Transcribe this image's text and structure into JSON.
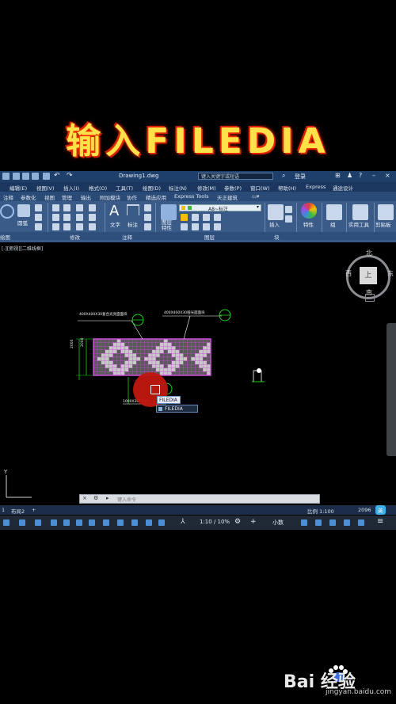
{
  "overlay": {
    "title": "输入FILEDIA"
  },
  "titlebar": {
    "document": "Drawing1.dwg",
    "search_placeholder": "键入关键字或短语",
    "user": "登录"
  },
  "menubar": {
    "items": [
      "编辑(E)",
      "视图(V)",
      "插入(I)",
      "格式(O)",
      "工具(T)",
      "绘图(D)",
      "标注(N)",
      "修改(M)",
      "参数(P)",
      "窗口(W)",
      "帮助(H)",
      "Express",
      "通途设计"
    ]
  },
  "ribbon_tabs": {
    "items": [
      "注释",
      "参数化",
      "视图",
      "管理",
      "输出",
      "附加模块",
      "协作",
      "精选应用",
      "Express Tools",
      "天正建筑"
    ]
  },
  "ribbon": {
    "layer_name": "A8~标注",
    "labels": {
      "line": "圆弧",
      "text": "文字",
      "dimension": "标注",
      "layer_props": "图层\n特性",
      "insert": "插入",
      "properties": "特性",
      "group": "组",
      "utilities": "实用工具",
      "clipboard": "剪贴板"
    },
    "panels": [
      "绘图",
      "修改",
      "注释",
      "图层",
      "块"
    ]
  },
  "viewport": {
    "label": "[-][俯视][二维线框]"
  },
  "viewcube": {
    "north": "北",
    "south": "南",
    "east": "东",
    "west": "西",
    "face": "上"
  },
  "drawing": {
    "label_left": "400X400X30复合光亮面面块",
    "label_right": "400X400X30哑光面面块",
    "label_bottom": "1000X300X30",
    "dim_a": "2000",
    "dim_b": "2000"
  },
  "command": {
    "typed": "FILEDIA",
    "suggestion": "FILEDIA",
    "placeholder": "键入命令"
  },
  "layout_tabs": {
    "items": [
      "1",
      "布局2",
      "+"
    ]
  },
  "status": {
    "scale": "比例 1:100",
    "coord": "2096",
    "anno_scale": "1:10 / 10%",
    "unit": "小数",
    "ime": "英"
  },
  "watermark": {
    "brand": "Bai 经验",
    "site": "jingyan.baidu.com"
  },
  "colors": {
    "accent": "#1f3f6b",
    "title_yellow": "#ffe14a",
    "grid_magenta": "#d04be0",
    "tile_gray": "#9a9a9a",
    "pointer_red": "#c0170f",
    "leader_green": "#1cd11c"
  }
}
